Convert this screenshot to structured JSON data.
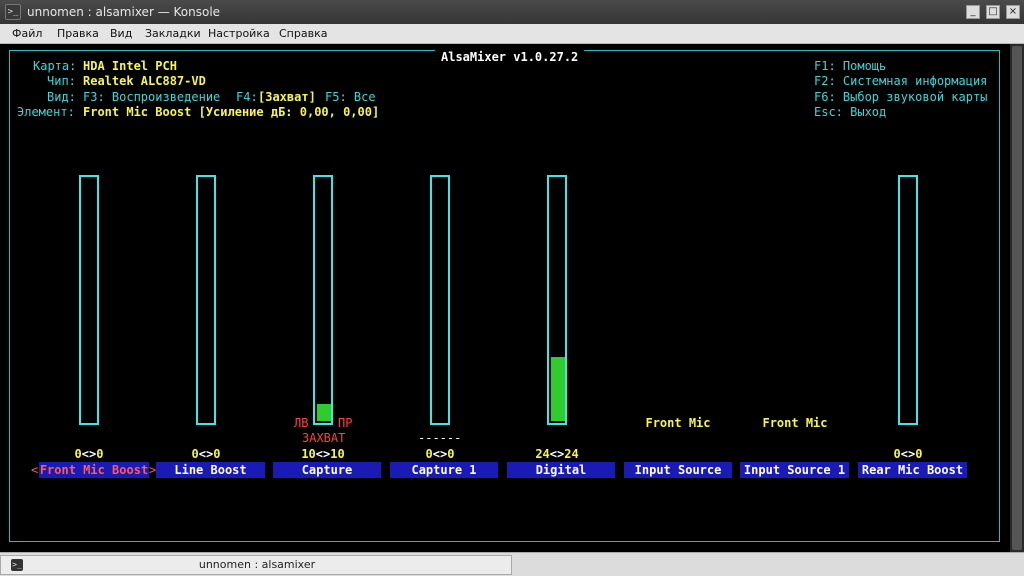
{
  "window": {
    "title": "unnomen : alsamixer — Konsole",
    "icon": "terminal-icon",
    "buttons": {
      "minimize": "_",
      "maximize": "□",
      "close": "×"
    }
  },
  "menu": [
    "Файл",
    "Правка",
    "Вид",
    "Закладки",
    "Настройка",
    "Справка"
  ],
  "mixer": {
    "title": "AlsaMixer v1.0.27.2",
    "info": {
      "card_label": "Карта:",
      "card": "HDA Intel PCH",
      "chip_label": "Чип:",
      "chip": "Realtek ALC887-VD",
      "view_label": "Вид:",
      "view_f3": "F3: Воспроизведение",
      "view_f4_key": "F4:",
      "view_f4": "[Захват]",
      "view_f5": "F5: Все",
      "element_label": "Элемент:",
      "element": "Front Mic Boost [Усиление дБ: 0,00, 0,00]"
    },
    "help": {
      "f1": "F1: Помощь",
      "f2": "F2: Системная информация",
      "f6": "F6: Выбор звуковой карты",
      "esc": "Esc: Выход"
    },
    "capture_left": "ЛВ",
    "capture_right": "ПР",
    "capture_state": "ЗАХВАТ",
    "capture1_state": "------",
    "sel_left_arrow": "<",
    "sel_right_arrow": ">",
    "controls": [
      {
        "name": "Front Mic Boost",
        "l": "0",
        "r": "0",
        "level": 0
      },
      {
        "name": "Line Boost",
        "l": "0",
        "r": "0",
        "level": 0
      },
      {
        "name": "Capture",
        "l": "10",
        "r": "10",
        "level": 0.07
      },
      {
        "name": "Capture 1",
        "l": "0",
        "r": "0",
        "level": 0
      },
      {
        "name": "Digital",
        "l": "24",
        "r": "24",
        "level": 0.26
      },
      {
        "name": "Input Source",
        "enum": "Front Mic"
      },
      {
        "name": "Input Source 1",
        "enum": "Front Mic"
      },
      {
        "name": "Rear Mic Boost",
        "l": "0",
        "r": "0",
        "level": 0
      }
    ],
    "sep": "<>"
  },
  "tab": {
    "label": "unnomen : alsamixer",
    "icon": "terminal-icon"
  },
  "colors": {
    "frame": "#2fb8b8",
    "bar_border": "#3fe6e6",
    "fill": "#2ecc2e",
    "label_bg": "#1a1ab4",
    "value": "#f6f64a"
  }
}
